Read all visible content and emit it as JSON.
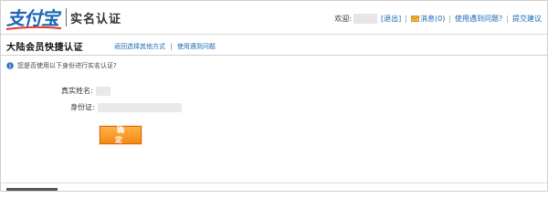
{
  "header": {
    "logo_text": "支付宝",
    "page_title": "实名认证",
    "welcome": "欢迎:",
    "logout": "[退出]",
    "messages": "消息(0)",
    "help": "使用遇到问题?",
    "feedback": "提交建议"
  },
  "section": {
    "title": "大陆会员快捷认证",
    "link_other_method": "返回选择其他方式",
    "link_problem": "使用遇到问题"
  },
  "info": {
    "text": "您是否使用以下身份进行实名认证?"
  },
  "form": {
    "name_label": "真实姓名:",
    "id_label": "身份证:",
    "confirm_button": "确 定"
  },
  "colors": {
    "link": "#1b67b5",
    "button": "#f48a12",
    "logo": "#1b67b5"
  },
  "icons": {
    "info": "info-icon",
    "messages": "envelope-icon"
  }
}
